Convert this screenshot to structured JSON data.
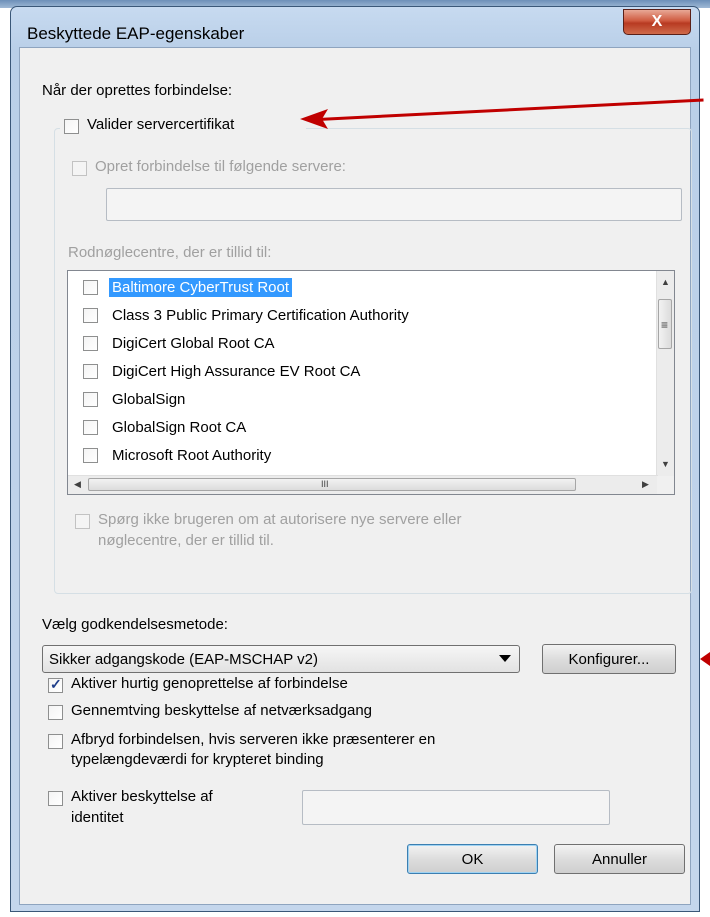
{
  "window": {
    "title": "Beskyttede EAP-egenskaber",
    "close_glyph": "X"
  },
  "connection_section": {
    "heading": "Når der oprettes forbindelse:",
    "validate_cert": {
      "label": "Valider servercertifikat",
      "checked": false
    },
    "connect_servers": {
      "label": "Opret forbindelse til følgende servere:",
      "checked": false,
      "value": ""
    },
    "trusted_roots_label": "Rodnøglecentre, der er tillid til:",
    "trusted_roots": [
      {
        "label": "Baltimore CyberTrust Root",
        "checked": false,
        "selected": true
      },
      {
        "label": "Class 3 Public Primary Certification Authority",
        "checked": false,
        "selected": false
      },
      {
        "label": "DigiCert Global Root CA",
        "checked": false,
        "selected": false
      },
      {
        "label": "DigiCert High Assurance EV Root CA",
        "checked": false,
        "selected": false
      },
      {
        "label": "GlobalSign",
        "checked": false,
        "selected": false
      },
      {
        "label": "GlobalSign Root CA",
        "checked": false,
        "selected": false
      },
      {
        "label": "Microsoft Root Authority",
        "checked": false,
        "selected": false
      }
    ],
    "dont_prompt": {
      "label_line1": "Spørg ikke brugeren om at autorisere nye servere eller",
      "label_line2": "nøglecentre, der er tillid til.",
      "checked": false
    }
  },
  "auth_section": {
    "heading": "Vælg godkendelsesmetode:",
    "method_selected": "Sikker adgangskode (EAP-MSCHAP v2)",
    "configure_button": "Konfigurer..."
  },
  "options": [
    {
      "label": "Aktiver hurtig genoprettelse af forbindelse",
      "checked": true
    },
    {
      "label": "Gennemtving beskyttelse af netværksadgang",
      "checked": false
    },
    {
      "label_line1": "Afbryd forbindelsen, hvis serveren ikke præsenterer en",
      "label_line2": "typelængdeværdi for krypteret binding",
      "checked": false
    },
    {
      "label_line1": "Aktiver beskyttelse af",
      "label_line2": "identitet",
      "checked": false,
      "value": ""
    }
  ],
  "buttons": {
    "ok": "OK",
    "cancel": "Annuller"
  },
  "scroll_glyphs": {
    "up": "▲",
    "down": "▼",
    "left": "◀",
    "right": "▶",
    "grip_v": "≡",
    "grip_h": "III"
  },
  "colors": {
    "selection": "#3399ff",
    "annotation_arrow": "#c00000",
    "checkmark": "#1f3e8a"
  }
}
